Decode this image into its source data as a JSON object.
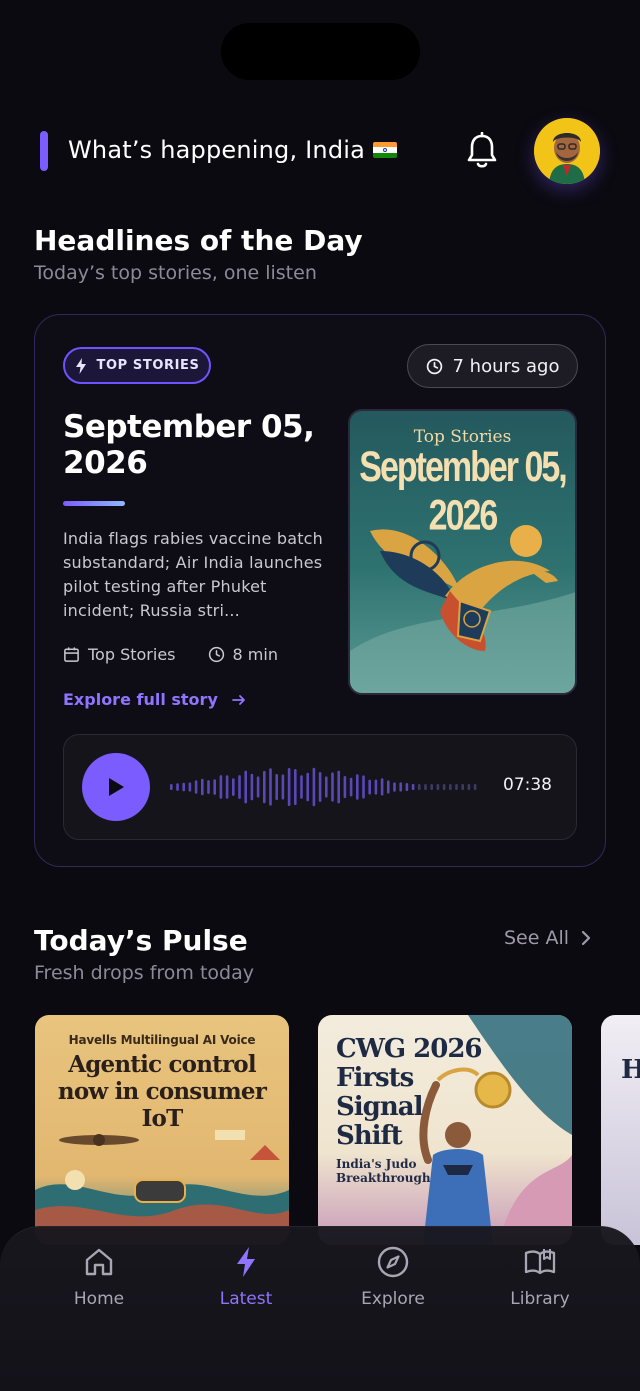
{
  "header": {
    "greeting": "What’s happening, India",
    "flag_colors": [
      "#ff9933",
      "#ffffff",
      "#138808"
    ]
  },
  "headlines": {
    "title": "Headlines of the Day",
    "subtitle": "Today’s top stories, one listen"
  },
  "story": {
    "badge": "TOP STORIES",
    "time_ago": "7 hours ago",
    "title": "September 05, 2026",
    "description": "India flags rabies vaccine batch substandard; Air India launches pilot testing after Phuket incident; Russia stri...",
    "category": "Top Stories",
    "duration_read": "8 min",
    "explore_label": "Explore full story",
    "cover_top": "Top Stories",
    "cover_date": "September 05, 2026",
    "player": {
      "duration": "07:38",
      "state": "paused"
    }
  },
  "pulse": {
    "title": "Today’s Pulse",
    "subtitle": "Fresh drops from today",
    "see_all": "See All",
    "cards": [
      {
        "kicker": "Havells Multilingual AI Voice",
        "headline": "Agentic control now in consumer IoT"
      },
      {
        "headline": "CWG 2026 Firsts Signal Shift",
        "sub": "India's Judo Breakthrough"
      },
      {
        "headline": "H"
      }
    ]
  },
  "tabs": [
    {
      "label": "Home",
      "icon": "home-icon",
      "active": false
    },
    {
      "label": "Latest",
      "icon": "bolt-icon",
      "active": true
    },
    {
      "label": "Explore",
      "icon": "compass-icon",
      "active": false
    },
    {
      "label": "Library",
      "icon": "book-icon",
      "active": false
    }
  ],
  "colors": {
    "accent": "#7b5cff",
    "background": "#0b0a10"
  }
}
